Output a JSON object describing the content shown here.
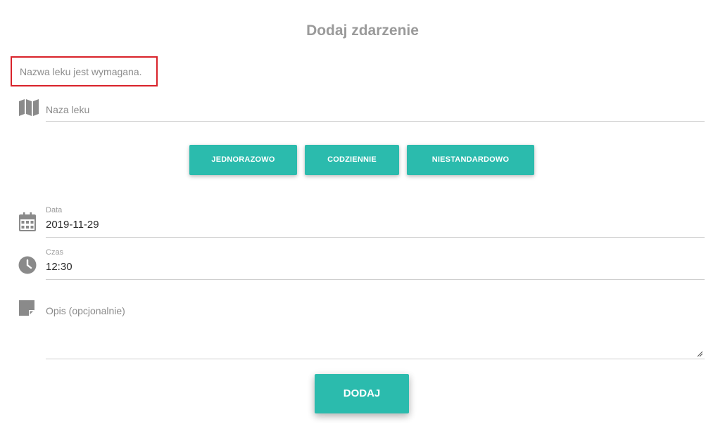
{
  "form": {
    "title": "Dodaj zdarzenie",
    "error_message": "Nazwa leku jest wymagana.",
    "drug_name": {
      "placeholder": "Naza leku",
      "value": "",
      "icon": "map-icon"
    },
    "frequency_buttons": [
      {
        "label": "JEDNORAZOWO"
      },
      {
        "label": "CODZIENNIE"
      },
      {
        "label": "NIESTANDARDOWO"
      }
    ],
    "date": {
      "label": "Data",
      "value": "2019-11-29",
      "icon": "calendar-icon"
    },
    "time": {
      "label": "Czas",
      "value": "12:30",
      "icon": "clock-icon"
    },
    "description": {
      "placeholder": "Opis (opcjonalnie)",
      "value": "",
      "icon": "note-icon"
    },
    "submit_label": "DODAJ"
  },
  "colors": {
    "accent": "#2bbbad",
    "error_border": "#d9222a",
    "icon": "#8a8a8a"
  }
}
